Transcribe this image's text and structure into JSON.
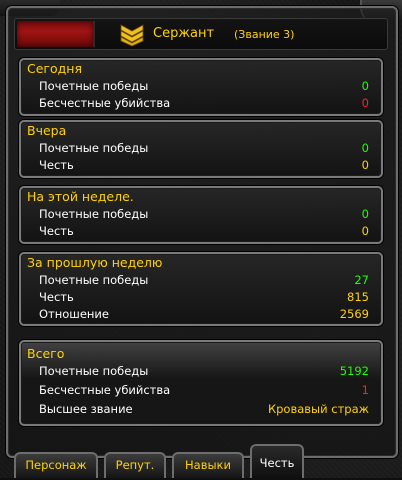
{
  "header": {
    "rank_name": "Сержант",
    "rank_level": "(Звание 3)",
    "rank_icon": "sergeant-chevrons-icon",
    "colors": {
      "rank_text": "#ffd200",
      "bar": "#a01414"
    }
  },
  "sections": {
    "today": {
      "title": "Сегодня",
      "rows": [
        {
          "label": "Почетные победы",
          "value": "0"
        },
        {
          "label": "Бесчестные убийства",
          "value": "0"
        }
      ]
    },
    "yesterday": {
      "title": "Вчера",
      "rows": [
        {
          "label": "Почетные победы",
          "value": "0"
        },
        {
          "label": "Честь",
          "value": "0"
        }
      ]
    },
    "this_week": {
      "title": "На этой неделе.",
      "rows": [
        {
          "label": "Почетные победы",
          "value": "0"
        },
        {
          "label": "Честь",
          "value": "0"
        }
      ]
    },
    "last_week": {
      "title": "За прошлую неделю",
      "rows": [
        {
          "label": "Почетные победы",
          "value": "27"
        },
        {
          "label": "Честь",
          "value": "815"
        },
        {
          "label": "Отношение",
          "value": "2569"
        }
      ]
    },
    "total": {
      "title": "Всего",
      "rows": [
        {
          "label": "Почетные победы",
          "value": "5192"
        },
        {
          "label": "Бесчестные убийства",
          "value": "1"
        },
        {
          "label": "Высшее звание",
          "value": "Кровавый страж"
        }
      ]
    }
  },
  "tabs": [
    {
      "label": "Персонаж",
      "active": false
    },
    {
      "label": "Репут.",
      "active": false
    },
    {
      "label": "Навыки",
      "active": false
    },
    {
      "label": "Честь",
      "active": true
    }
  ],
  "colors": {
    "positive": "#1eff00",
    "negative": "#ff2020",
    "neutral": "#ffd200",
    "label": "#ffffff"
  }
}
